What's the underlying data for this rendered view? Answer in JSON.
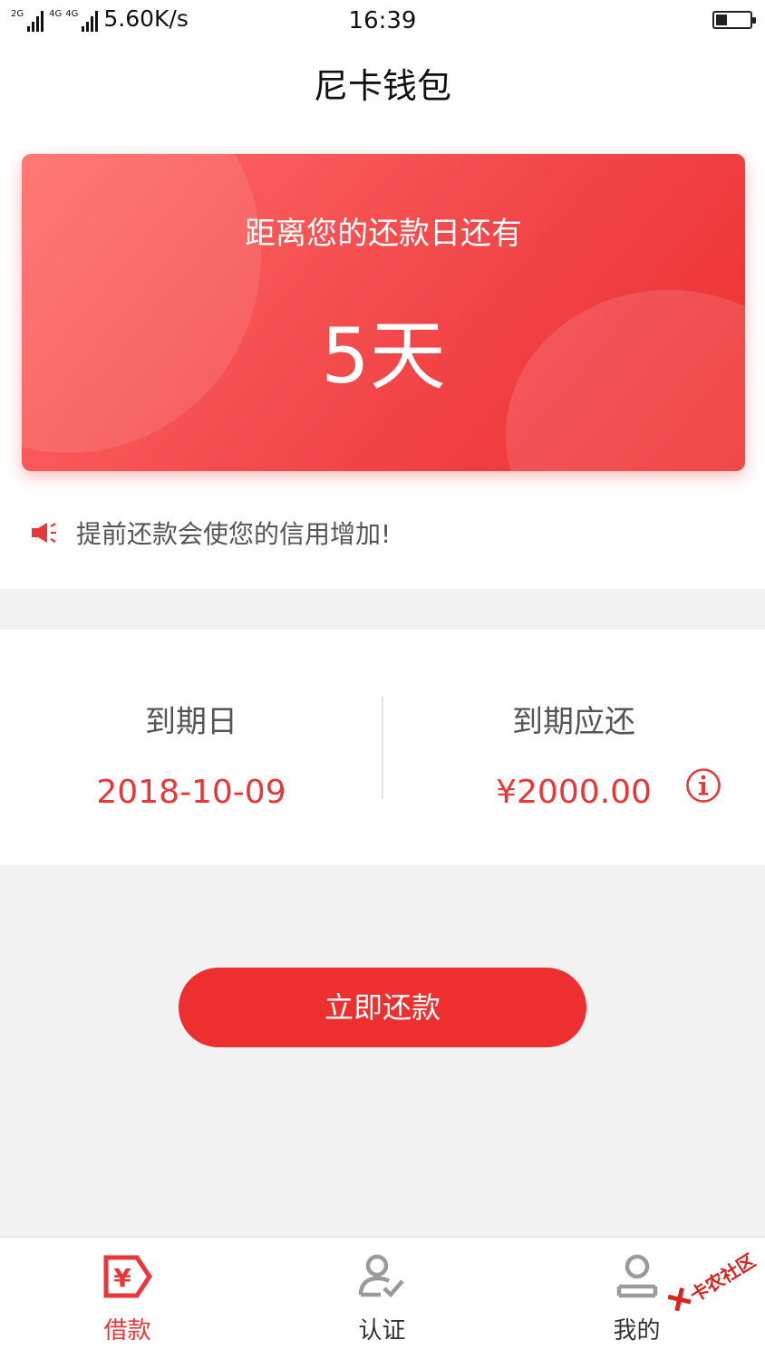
{
  "status_bar": {
    "net_left": "2G",
    "net_mid": "4G",
    "net_right": "4G",
    "speed": "5.60K/s",
    "time": "16:39"
  },
  "header": {
    "title": "尼卡钱包"
  },
  "countdown_card": {
    "label": "距离您的还款日还有",
    "days": "5天"
  },
  "notice": {
    "text": "提前还款会使您的信用增加!",
    "icon": "megaphone-icon"
  },
  "repayment_info": {
    "due_date_label": "到期日",
    "due_date": "2018-10-09",
    "amount_label": "到期应还",
    "amount": "¥2000.00",
    "info_icon": "info-icon"
  },
  "pay_button": {
    "label": "立即还款"
  },
  "tabbar": {
    "items": [
      {
        "label": "借款",
        "icon": "loan-icon",
        "active": true
      },
      {
        "label": "认证",
        "icon": "verify-user-icon",
        "active": false
      },
      {
        "label": "我的",
        "icon": "profile-icon",
        "active": false
      }
    ]
  },
  "watermark": {
    "text": "卡农社区"
  },
  "colors": {
    "accent": "#EE2F2F",
    "text_red": "#E8373A",
    "background": "#F2F2F2"
  }
}
